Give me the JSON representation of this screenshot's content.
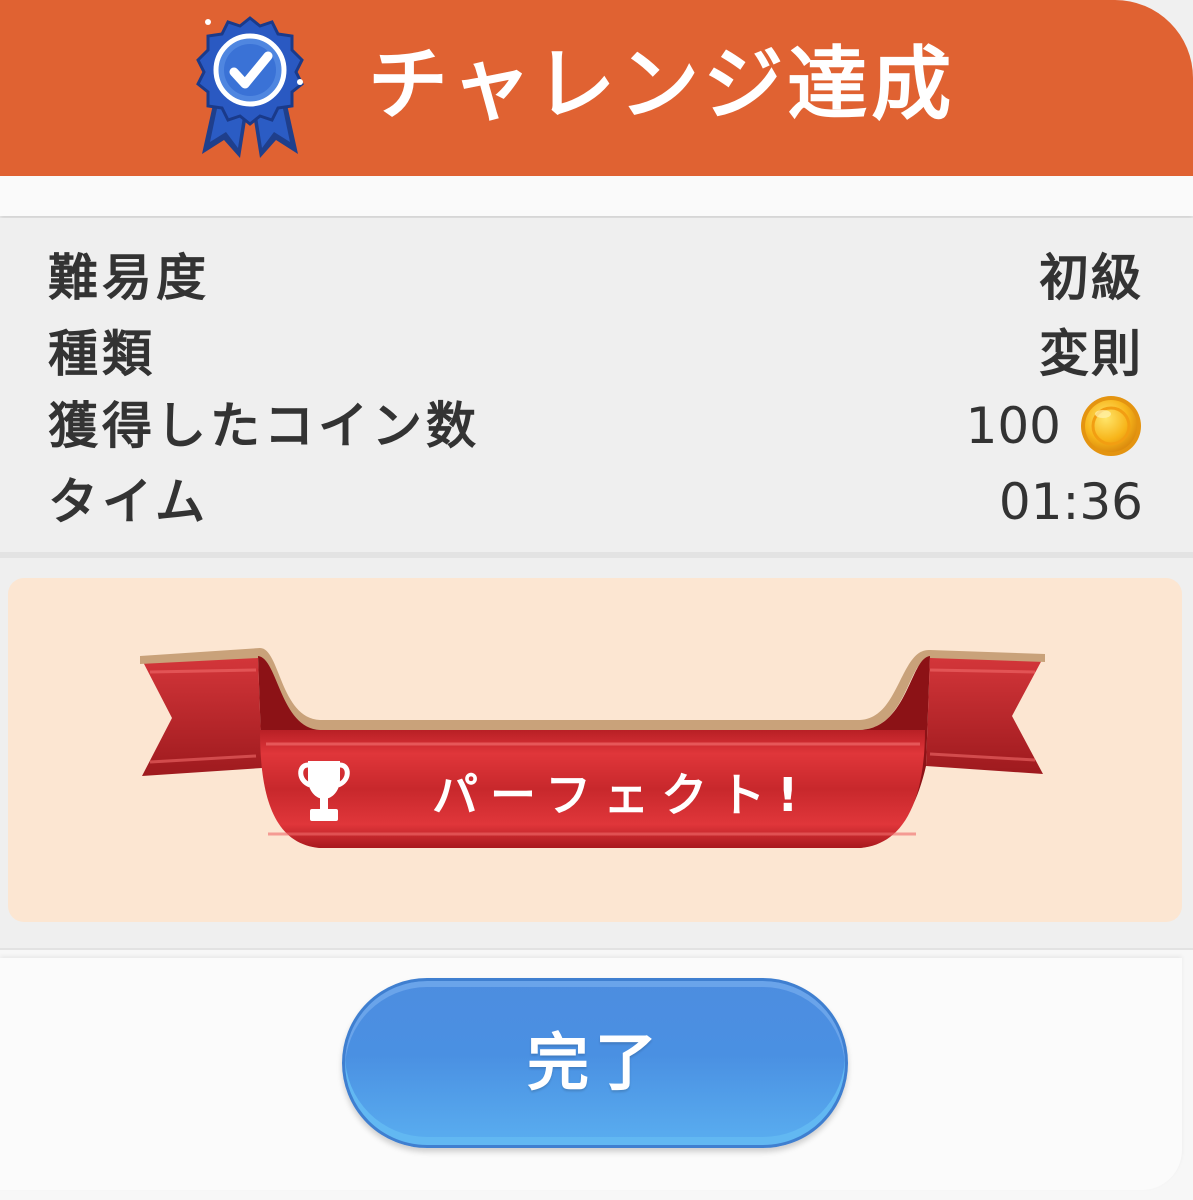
{
  "header": {
    "title": "チャレンジ達成",
    "badge_icon": "award-ribbon-check-icon"
  },
  "stats": [
    {
      "label": "難易度",
      "value": "初級"
    },
    {
      "label": "種類",
      "value": "変則"
    },
    {
      "label": "獲得したコイン数",
      "value": "100",
      "icon": "coin-icon"
    },
    {
      "label": "タイム",
      "value": "01:36"
    }
  ],
  "result": {
    "text": "パーフェクト!",
    "icon": "trophy-icon"
  },
  "footer": {
    "done_label": "完了"
  },
  "colors": {
    "header": "#e06232",
    "panel": "#fce6d2",
    "ribbon": "#c8282c",
    "button": "#4a90e2"
  }
}
